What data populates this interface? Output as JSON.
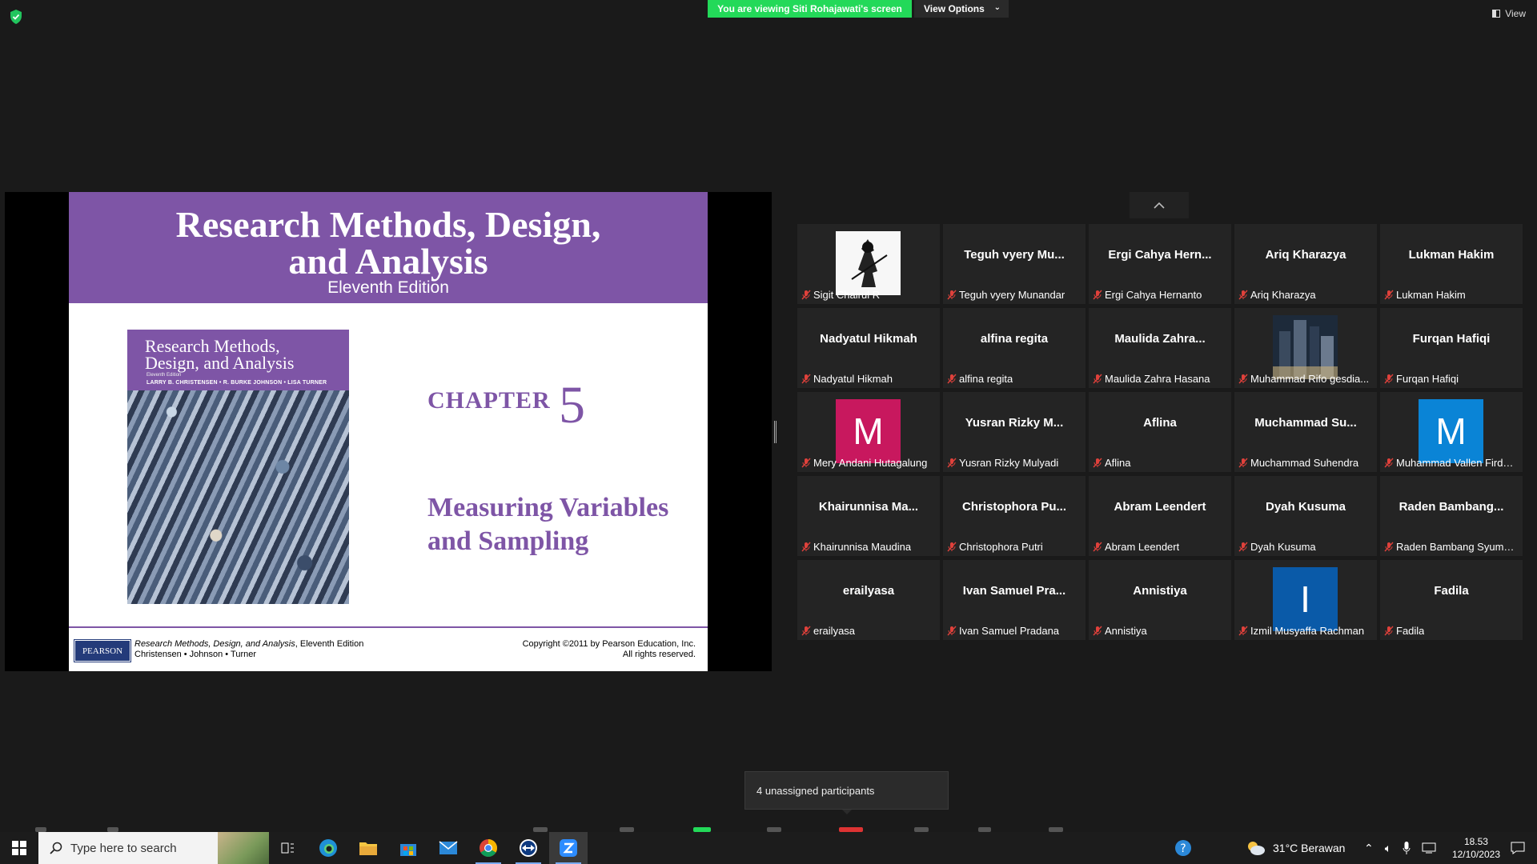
{
  "top": {
    "banner": "You are viewing Siti Rohajawati's screen",
    "view_options": "View Options",
    "view": "View"
  },
  "slide": {
    "title_line1": "Research Methods, Design,",
    "title_line2": "and Analysis",
    "edition": "Eleventh Edition",
    "cover_title_line1": "Research Methods,",
    "cover_title_line2": "Design, and Analysis",
    "cover_edition": "Eleventh Edition",
    "cover_authors": "LARRY B. CHRISTENSEN • R. BURKE JOHNSON • LISA TURNER",
    "chapter_label": "CHAPTER",
    "chapter_number": "5",
    "chapter_title_line1": "Measuring Variables",
    "chapter_title_line2": "and Sampling",
    "publisher": "PEARSON",
    "footer_book": "Research Methods, Design, and Analysis",
    "footer_book_edition": ", Eleventh Edition",
    "footer_authors": "Christensen • Johnson • Turner",
    "copyright": "Copyright ©2011 by Pearson Education, Inc.",
    "rights": "All rights reserved."
  },
  "participants": [
    {
      "display": "",
      "label": "Sigit Chairul R",
      "type": "photo-samurai"
    },
    {
      "display": "Teguh vyery Mu...",
      "label": "Teguh vyery Munandar"
    },
    {
      "display": "Ergi Cahya Hern...",
      "label": "Ergi Cahya Hernanto"
    },
    {
      "display": "Ariq Kharazya",
      "label": "Ariq Kharazya"
    },
    {
      "display": "Lukman Hakim",
      "label": "Lukman Hakim"
    },
    {
      "display": "Nadyatul Hikmah",
      "label": "Nadyatul Hikmah"
    },
    {
      "display": "alfina regita",
      "label": "alfina regita"
    },
    {
      "display": "Maulida Zahra...",
      "label": "Maulida Zahra Hasana"
    },
    {
      "display": "",
      "label": "Muhammad Rifo gesdia...",
      "type": "photo-city"
    },
    {
      "display": "Furqan Hafiqi",
      "label": "Furqan Hafiqi"
    },
    {
      "display": "M",
      "label": "Mery Andani Hutagalung",
      "type": "avatar",
      "color": "#c8185e"
    },
    {
      "display": "Yusran Rizky M...",
      "label": "Yusran Rizky Mulyadi"
    },
    {
      "display": "Aflina",
      "label": "Aflina"
    },
    {
      "display": "Muchammad Su...",
      "label": "Muchammad Suhendra"
    },
    {
      "display": "M",
      "label": "Muhammad Vallen Firda...",
      "type": "avatar",
      "color": "#0a84d6"
    },
    {
      "display": "Khairunnisa Ma...",
      "label": "Khairunnisa Maudina"
    },
    {
      "display": "Christophora Pu...",
      "label": "Christophora Putri"
    },
    {
      "display": "Abram Leendert",
      "label": "Abram Leendert"
    },
    {
      "display": "Dyah Kusuma",
      "label": "Dyah Kusuma"
    },
    {
      "display": "Raden Bambang...",
      "label": "Raden Bambang Syuma..."
    },
    {
      "display": "erailyasa",
      "label": "erailyasa"
    },
    {
      "display": "Ivan Samuel Pra...",
      "label": "Ivan Samuel Pradana"
    },
    {
      "display": "Annistiya",
      "label": "Annistiya"
    },
    {
      "display": "I",
      "label": "Izmil Musyaffa Rachman",
      "type": "avatar",
      "color": "#0a5aa8"
    },
    {
      "display": "Fadila",
      "label": "Fadila"
    }
  ],
  "toast": "4 unassigned participants",
  "taskbar": {
    "search_placeholder": "Type here to search",
    "weather": "31°C  Berawan",
    "time": "18.53",
    "date": "12/10/2023"
  }
}
